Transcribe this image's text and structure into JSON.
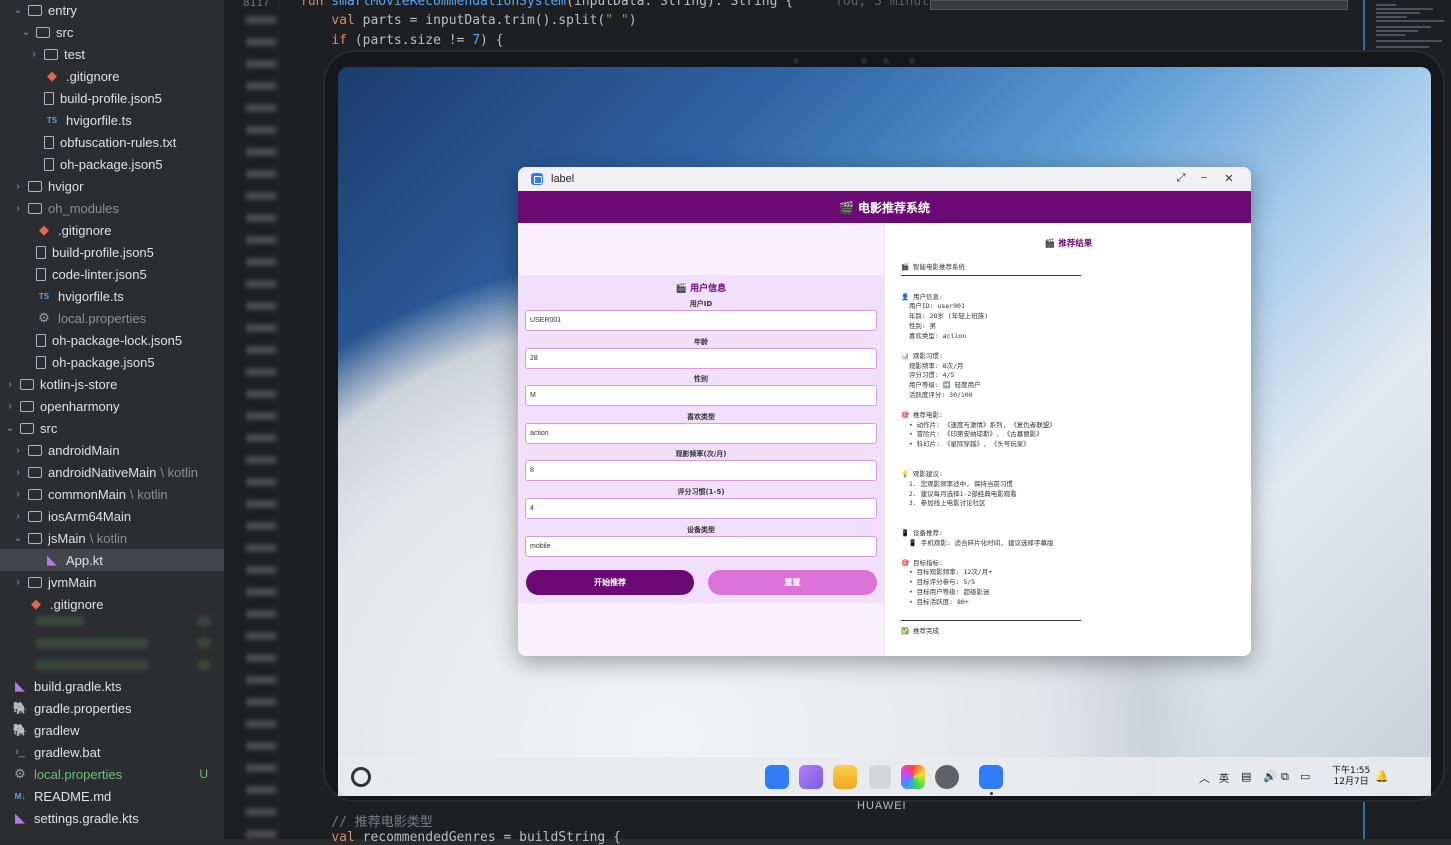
{
  "ide": {
    "tree": [
      {
        "label": "entry",
        "icon": "folder-icon",
        "indent": 1,
        "open": true
      },
      {
        "label": "src",
        "icon": "source-folder-icon",
        "indent": 2,
        "open": true
      },
      {
        "label": "test",
        "icon": "source-folder-icon",
        "indent": 3,
        "open": false
      },
      {
        "label": ".gitignore",
        "icon": "git-icon",
        "indent": 3
      },
      {
        "label": "build-profile.json5",
        "icon": "file-icon",
        "indent": 3
      },
      {
        "label": "hvigorfile.ts",
        "icon": "ts-icon",
        "indent": 3
      },
      {
        "label": "obfuscation-rules.txt",
        "icon": "file-icon",
        "indent": 3
      },
      {
        "label": "oh-package.json5",
        "icon": "file-icon",
        "indent": 3
      },
      {
        "label": "hvigor",
        "icon": "folder-icon",
        "indent": 1,
        "open": false
      },
      {
        "label": "oh_modules",
        "icon": "folder-icon",
        "indent": 1,
        "open": false,
        "muted": true
      },
      {
        "label": ".gitignore",
        "icon": "git-icon",
        "indent": 2
      },
      {
        "label": "build-profile.json5",
        "icon": "file-icon",
        "indent": 2
      },
      {
        "label": "code-linter.json5",
        "icon": "file-icon",
        "indent": 2
      },
      {
        "label": "hvigorfile.ts",
        "icon": "ts-icon",
        "indent": 2
      },
      {
        "label": "local.properties",
        "icon": "gear-icon",
        "indent": 2,
        "muted": true
      },
      {
        "label": "oh-package-lock.json5",
        "icon": "file-icon",
        "indent": 2
      },
      {
        "label": "oh-package.json5",
        "icon": "file-icon",
        "indent": 2
      },
      {
        "label": "kotlin-js-store",
        "icon": "folder-icon",
        "indent": 0,
        "open": false
      },
      {
        "label": "openharmony",
        "icon": "folder-icon",
        "indent": 0,
        "open": false
      },
      {
        "label": "src",
        "icon": "source-folder-icon",
        "indent": 0,
        "open": true
      },
      {
        "label": "androidMain",
        "icon": "folder-icon",
        "indent": 1,
        "open": false
      },
      {
        "label": "androidNativeMain",
        "suffix": "\\ kotlin",
        "icon": "folder-icon",
        "indent": 1,
        "open": false
      },
      {
        "label": "commonMain",
        "suffix": "\\ kotlin",
        "icon": "folder-icon",
        "indent": 1,
        "open": false
      },
      {
        "label": "iosArm64Main",
        "icon": "folder-icon",
        "indent": 1,
        "open": false
      },
      {
        "label": "jsMain",
        "suffix": "\\ kotlin",
        "icon": "folder-icon",
        "indent": 1,
        "open": true
      },
      {
        "label": "App.kt",
        "icon": "kotlin-icon",
        "indent": 3,
        "selected": true
      },
      {
        "label": "jvmMain",
        "icon": "folder-icon",
        "indent": 1,
        "open": false
      },
      {
        "label": ".gitignore",
        "icon": "git-icon",
        "indent": 1
      }
    ],
    "tree_bottom": [
      {
        "label": "build.gradle.kts",
        "icon": "kotlin-icon"
      },
      {
        "label": "gradle.properties",
        "icon": "gradle-icon"
      },
      {
        "label": "gradlew",
        "icon": "gradle-icon"
      },
      {
        "label": "gradlew.bat",
        "icon": "terminal-icon"
      },
      {
        "label": "local.properties",
        "icon": "gear-icon",
        "green": true,
        "badge": "U"
      },
      {
        "label": "README.md",
        "icon": "md-icon"
      },
      {
        "label": "settings.gradle.kts",
        "icon": "kotlin-icon"
      }
    ],
    "line_number": "8117",
    "code_top": [
      "fun smartMovieRecommendationSystem(inputData: String): String {",
      "    val parts = inputData.trim().split(\" \")",
      "    if (parts.size != 7) {"
    ],
    "inline_hint": "You, 3 minut",
    "code_bottom": [
      "    // 推荐电影类型",
      "    val recommendedGenres = buildString {"
    ]
  },
  "device": {
    "brand": "HUAWEI"
  },
  "app": {
    "window_title": "label",
    "header": "🎬 电影推荐系统",
    "form_title": "🎬 用户信息",
    "fields": [
      {
        "label": "用户ID",
        "value": "USER001"
      },
      {
        "label": "年龄",
        "value": "28"
      },
      {
        "label": "性别",
        "value": "M"
      },
      {
        "label": "喜欢类型",
        "value": "action"
      },
      {
        "label": "观影频率(次/月)",
        "value": "8"
      },
      {
        "label": "评分习惯(1-5)",
        "value": "4"
      },
      {
        "label": "设备类型",
        "value": "mobile"
      }
    ],
    "start_button": "开始推荐",
    "reset_button": "重置",
    "result_title": "🎬 推荐结果",
    "result_lines": [
      "🎬 智能电影推荐系统",
      "---",
      "",
      "👤 用户信息:",
      "  用户ID: user001",
      "  年龄: 28岁 (年轻上班族)",
      "  性别: 男",
      "  喜欢类型: action",
      "",
      "📊 观影习惯:",
      "  观影频率: 8次/月",
      "  评分习惯: 4/5",
      "  用户等级: ➡️ 轻度用户",
      "  活跃度评分: 30/100",
      "",
      "🎯 推荐电影:",
      "  • 动作片: 《速度与激情》系列, 《复仇者联盟》",
      "  • 冒险片: 《印第安纳琼斯》, 《古墓丽影》",
      "  • 科幻片: 《星际穿越》, 《头号玩家》",
      "",
      "",
      "💡 观影建议:",
      "  1. 您观影频率适中, 保持当前习惯",
      "  2. 建议每月选择1-2部经典电影观看",
      "  3. 参加线上电影讨论社区",
      "",
      "",
      "📱 设备推荐:",
      "  📱 手机观影: 适合碎片化时间, 建议选择字幕版",
      "",
      "🎯 目标指标:",
      "  • 目标观影频率: 12次/月+",
      "  • 目标评分参与: 5/5",
      "  • 目标用户等级: 超级影迷",
      "  • 目标活跃度: 80+",
      "",
      "---",
      "✅ 推荐完成"
    ]
  },
  "taskbar": {
    "time": "下午1:55",
    "date": "12月7日",
    "ime": "英"
  },
  "colors": {
    "accent": "#6b0a75",
    "reset": "#da72d8",
    "form_bg": "#f2dffc"
  }
}
